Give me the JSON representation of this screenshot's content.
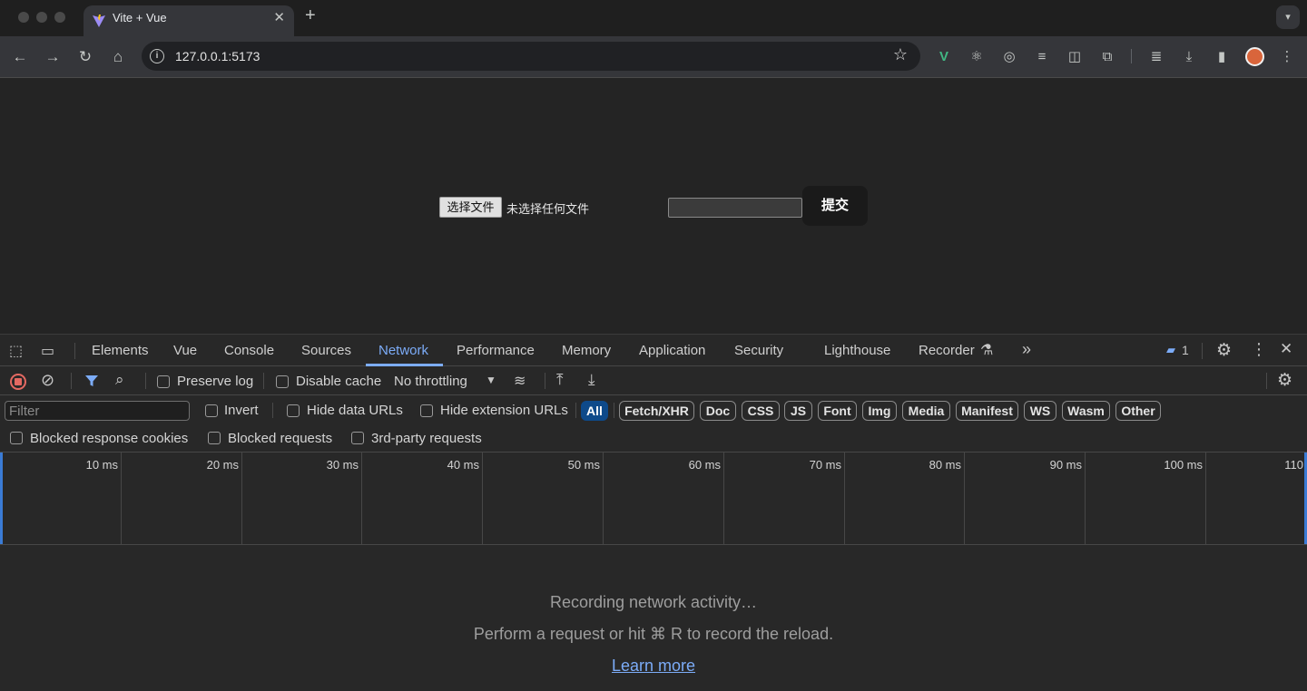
{
  "browser": {
    "tab_title": "Vite + Vue",
    "tab_close": "✕",
    "new_tab": "+",
    "url": "127.0.0.1:5173"
  },
  "page": {
    "file_button": "选择文件",
    "file_status": "未选择任何文件",
    "text_value": "",
    "submit_button": "提交"
  },
  "devtools": {
    "tabs": [
      "Elements",
      "Vue",
      "Console",
      "Sources",
      "Network",
      "Performance",
      "Memory",
      "Application",
      "Security",
      "Lighthouse",
      "Recorder"
    ],
    "active_tab": "Network",
    "messages_count": "1",
    "preserve_log": "Preserve log",
    "disable_cache": "Disable cache",
    "throttling": "No throttling",
    "filter_placeholder": "Filter",
    "invert": "Invert",
    "hide_data_urls": "Hide data URLs",
    "hide_extension_urls": "Hide extension URLs",
    "type_filters": [
      "All",
      "Fetch/XHR",
      "Doc",
      "CSS",
      "JS",
      "Font",
      "Img",
      "Media",
      "Manifest",
      "WS",
      "Wasm",
      "Other"
    ],
    "blocked_response_cookies": "Blocked response cookies",
    "blocked_requests": "Blocked requests",
    "third_party_requests": "3rd-party requests",
    "timeline_ticks": [
      "10 ms",
      "20 ms",
      "30 ms",
      "40 ms",
      "50 ms",
      "60 ms",
      "70 ms",
      "80 ms",
      "90 ms",
      "100 ms",
      "110"
    ],
    "empty_title": "Recording network activity…",
    "empty_sub": "Perform a request or hit ⌘ R to record the reload.",
    "learn_more": "Learn more"
  }
}
